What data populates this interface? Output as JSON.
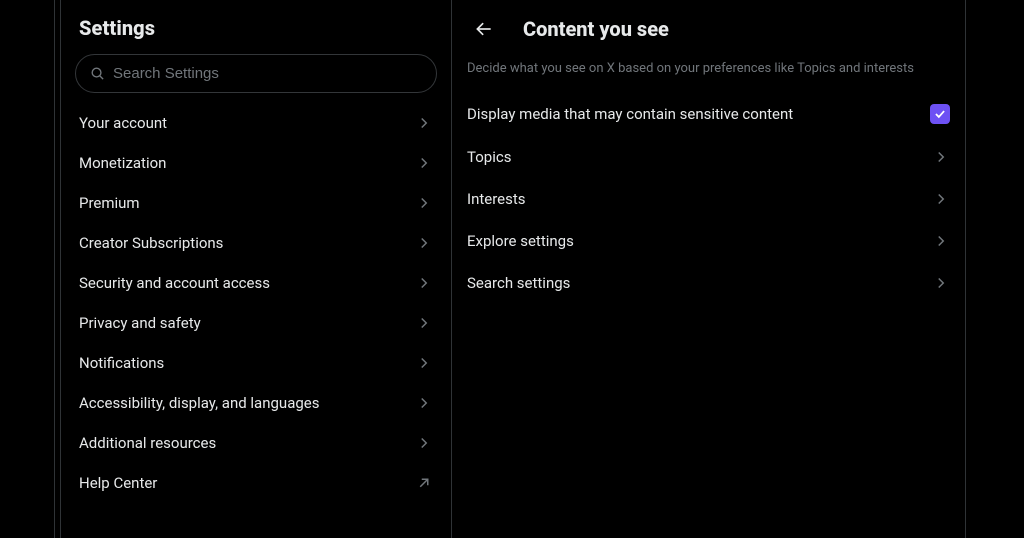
{
  "sidebar": {
    "title": "Settings",
    "search_placeholder": "Search Settings",
    "items": [
      {
        "label": "Your account"
      },
      {
        "label": "Monetization"
      },
      {
        "label": "Premium"
      },
      {
        "label": "Creator Subscriptions"
      },
      {
        "label": "Security and account access"
      },
      {
        "label": "Privacy and safety"
      },
      {
        "label": "Notifications"
      },
      {
        "label": "Accessibility, display, and languages"
      },
      {
        "label": "Additional resources"
      },
      {
        "label": "Help Center"
      }
    ]
  },
  "main": {
    "title": "Content you see",
    "description": "Decide what you see on X based on your preferences like Topics and interests",
    "items": [
      {
        "label": "Display media that may contain sensitive content",
        "kind": "checkbox",
        "checked": true
      },
      {
        "label": "Topics",
        "kind": "nav"
      },
      {
        "label": "Interests",
        "kind": "nav"
      },
      {
        "label": "Explore settings",
        "kind": "nav"
      },
      {
        "label": "Search settings",
        "kind": "nav"
      }
    ]
  },
  "colors": {
    "accent": "#6d51f4",
    "text_muted": "#71767b",
    "divider": "#2f3336"
  }
}
